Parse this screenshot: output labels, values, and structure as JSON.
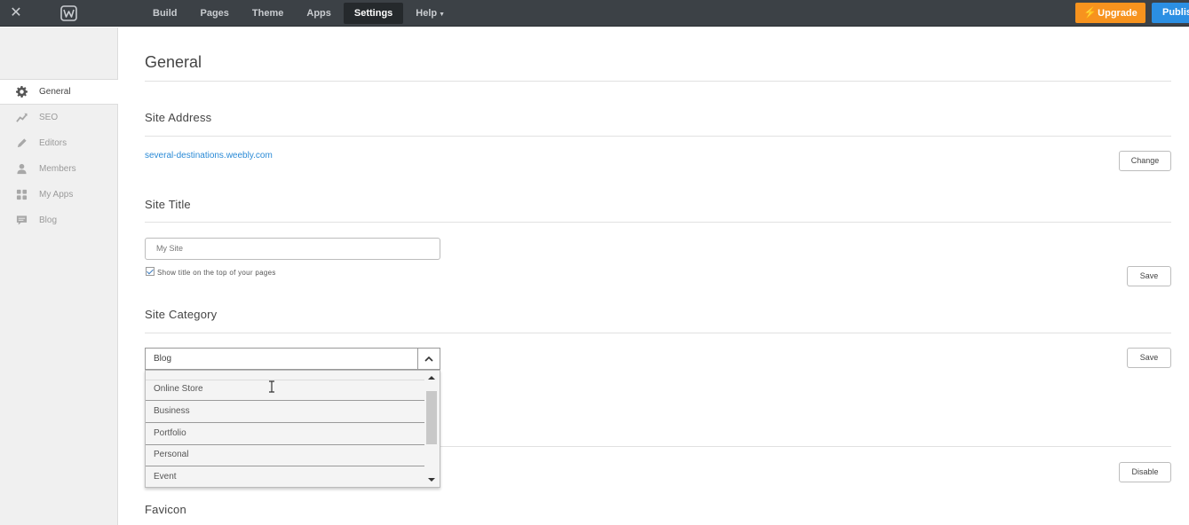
{
  "topbar": {
    "close_icon": "close-icon",
    "logo_icon": "weebly-logo-icon",
    "nav": [
      {
        "label": "Build"
      },
      {
        "label": "Pages"
      },
      {
        "label": "Theme"
      },
      {
        "label": "Apps"
      },
      {
        "label": "Settings",
        "active": true
      },
      {
        "label": "Help"
      }
    ],
    "upgrade_label": "Upgrade",
    "publish_label": "Publish",
    "colors": {
      "bar": "#3c4146",
      "upgrade": "#f7931e",
      "publish": "#2b8fe3"
    }
  },
  "sidebar": {
    "items": [
      {
        "label": "General",
        "icon": "gear-icon",
        "active": true
      },
      {
        "label": "SEO",
        "icon": "trend-chart-icon"
      },
      {
        "label": "Editors",
        "icon": "pencil-icon"
      },
      {
        "label": "Members",
        "icon": "user-icon"
      },
      {
        "label": "My Apps",
        "icon": "apps-grid-icon"
      },
      {
        "label": "Blog",
        "icon": "comment-icon"
      }
    ]
  },
  "main": {
    "title": "General",
    "site_address": {
      "heading": "Site Address",
      "url": "several-destinations.weebly.com",
      "change_label": "Change"
    },
    "site_title": {
      "heading": "Site Title",
      "input_value": "My Site",
      "show_title_label": "Show title on the top of your pages",
      "show_title_checked": true,
      "save_label": "Save"
    },
    "site_category": {
      "heading": "Site Category",
      "selected": "Blog",
      "options": [
        "Online Store",
        "Business",
        "Portfolio",
        "Personal",
        "Event"
      ],
      "save_label": "Save"
    },
    "disable_label": "Disable",
    "favicon_heading": "Favicon"
  }
}
